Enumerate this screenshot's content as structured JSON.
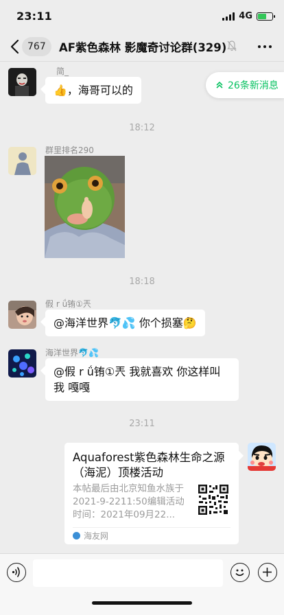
{
  "status_bar": {
    "time": "23:11",
    "network": "4G"
  },
  "nav": {
    "unread_count": "767",
    "title": "AF紫色森林 影魔奇讨论群(329)"
  },
  "new_messages_pill": {
    "label": "26条新消息"
  },
  "messages": [
    {
      "sender": "简_",
      "text": "👍，海哥可以的"
    },
    {
      "time": "18:12"
    },
    {
      "sender": "群里排名290",
      "image": "green-fish-mask-photo"
    },
    {
      "time": "18:18"
    },
    {
      "sender": "假 r ǘ铕①兲",
      "text": "@海洋世界🐬💦 你个损塞🤔"
    },
    {
      "sender": "海洋世界🐬💦",
      "text": "@假 r ǘ铕①兲 我就喜欢 你这样叫我 嘎嘎"
    },
    {
      "time": "23:11"
    },
    {
      "sender": "self",
      "card": {
        "title": "Aquaforest紫色森林生命之源（海泥）顶楼活动",
        "description": "本帖最后由北京知鱼水族于2021-9-2211:50编辑活动时间：2021年09月22...",
        "source": "海友网"
      }
    }
  ],
  "input": {
    "placeholder": ""
  },
  "colors": {
    "accent": "#07c160",
    "background": "#ededed",
    "bubble": "#ffffff"
  }
}
